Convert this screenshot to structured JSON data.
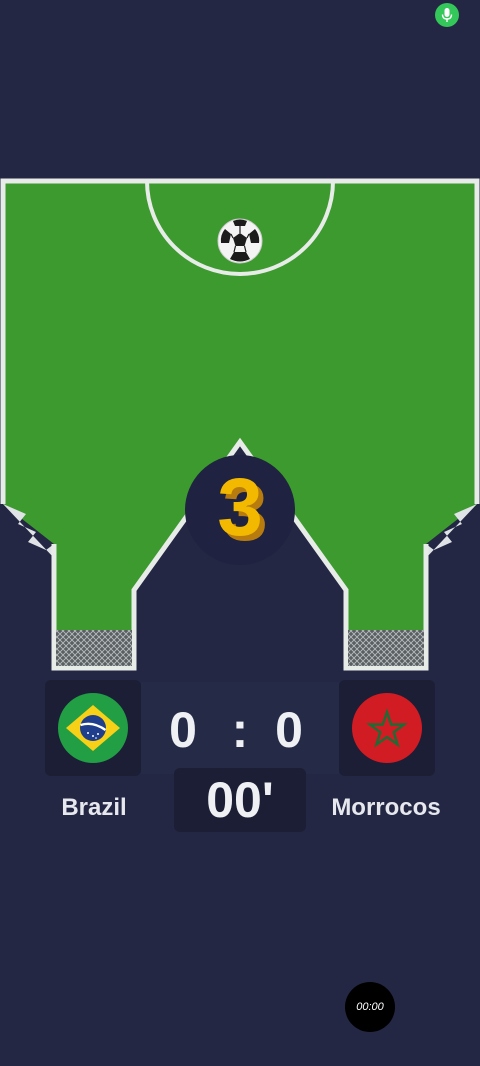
{
  "game": {
    "countdown": "3",
    "home_team": {
      "name": "Brazil",
      "score": "0",
      "flag": "brazil-flag-icon"
    },
    "away_team": {
      "name": "Morrocos",
      "score": "0",
      "flag": "morocco-flag-icon"
    },
    "score_separator": ":",
    "match_time": "00'"
  },
  "recording": {
    "elapsed": "00:00"
  },
  "icons": {
    "mic": "mic-icon",
    "ball": "soccer-ball-icon"
  },
  "colors": {
    "background": "#232744",
    "pitch": "#3c9a2f",
    "lines": "#e8ece8",
    "countdown": "#f2b900",
    "mic_indicator": "#34c759"
  }
}
